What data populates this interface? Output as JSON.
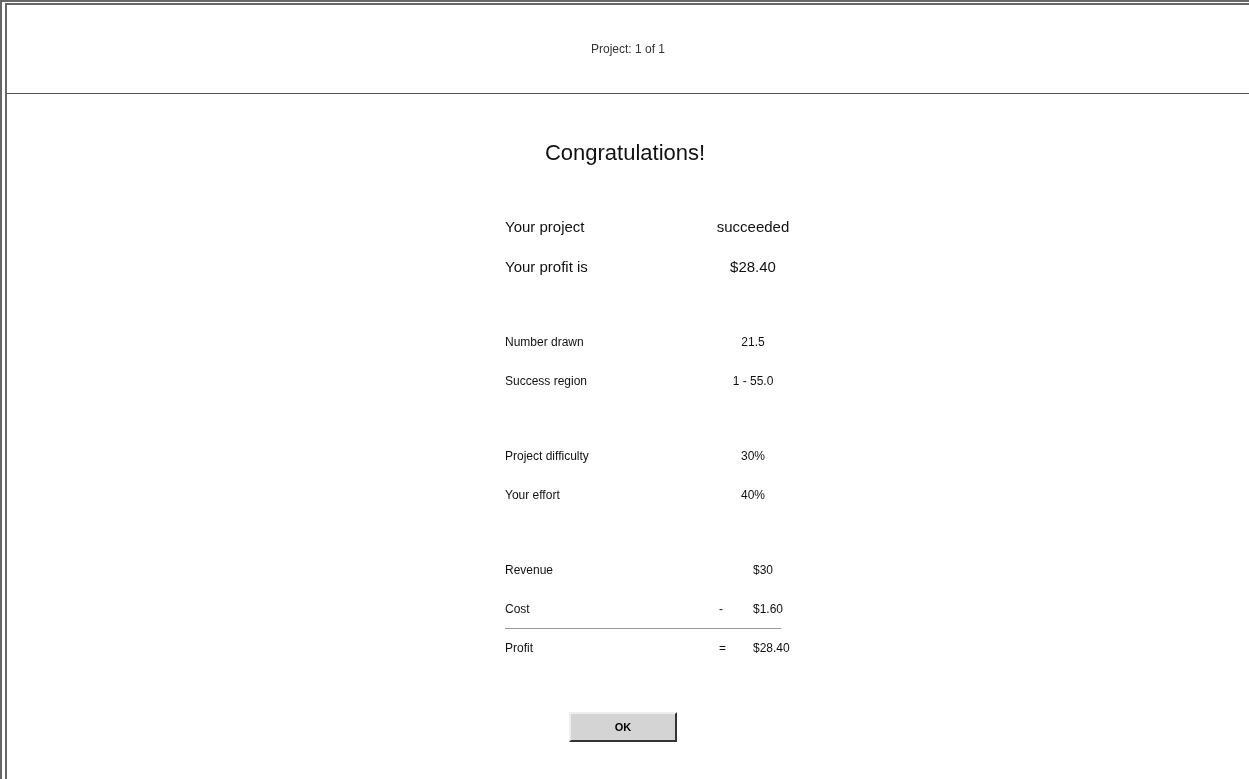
{
  "header": {
    "text": "Project: 1 of 1"
  },
  "title": "Congratulations!",
  "summary": [
    {
      "label": "Your project",
      "value": "succeeded"
    },
    {
      "label": "Your profit is",
      "value": "$28.40"
    }
  ],
  "groups": [
    [
      {
        "kind": "plain",
        "label": "Number drawn",
        "value": "21.5"
      },
      {
        "kind": "plain",
        "label": "Success region",
        "value": "1 - 55.0"
      }
    ],
    [
      {
        "kind": "plain",
        "label": "Project difficulty",
        "value": "30%"
      },
      {
        "kind": "plain",
        "label": "Your effort",
        "value": "40%"
      }
    ],
    [
      {
        "kind": "signed",
        "label": "Revenue",
        "value": "$30"
      },
      {
        "kind": "signed",
        "label": "Cost",
        "sign": "-",
        "value": "$1.60"
      },
      {
        "kind": "total",
        "label": "Profit",
        "sign": "=",
        "value": "$28.40"
      }
    ]
  ],
  "button": "OK"
}
